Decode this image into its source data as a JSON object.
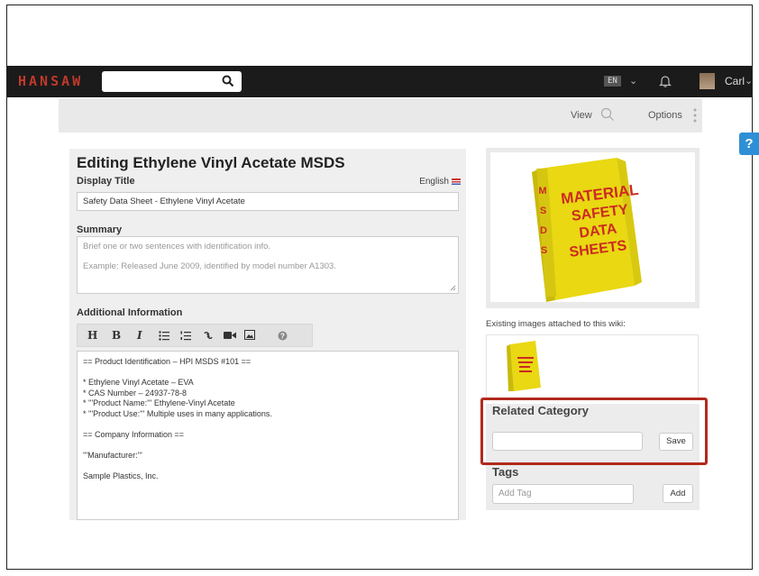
{
  "nav": {
    "logo": "HANSAW",
    "language": "EN",
    "user_name": "Carl"
  },
  "subbar": {
    "view_label": "View",
    "options_label": "Options"
  },
  "help_label": "?",
  "editor": {
    "heading": "Editing Ethylene Vinyl Acetate MSDS",
    "display_title_label": "Display Title",
    "language_label": "English",
    "display_title_value": "Safety Data Sheet - Ethylene Vinyl Acetate",
    "summary_label": "Summary",
    "summary_placeholder_line1": "Brief one or two sentences with identification info.",
    "summary_placeholder_line2": "Example: Released June 2009, identified by model number A1303.",
    "additional_label": "Additional Information",
    "toolbar": {
      "heading": "H",
      "bold": "B",
      "italic": "I"
    },
    "content_lines": [
      "== Product Identification – HPI MSDS #101 ==",
      "",
      "* Ethylene Vinyl Acetate – EVA",
      "* CAS Number – 24937-78-8",
      "* '''Product Name:''' Ethylene-Vinyl Acetate",
      "* '''Product Use:''' Multiple uses in many applications.",
      "",
      "== Company Information ==",
      "",
      "'''Manufacturer:'''",
      "",
      "Sample Plastics, Inc."
    ]
  },
  "sidebar": {
    "binder_lines": [
      "MATERIAL",
      "SAFETY",
      "DATA",
      "SHEETS"
    ],
    "binder_spine": [
      "M",
      "S",
      "D",
      "S"
    ],
    "existing_images_label": "Existing images attached to this wiki:",
    "related_category_title": "Related Category",
    "save_label": "Save",
    "tags_title": "Tags",
    "add_tag_placeholder": "Add Tag",
    "add_label": "Add"
  },
  "colors": {
    "brand": "#c0392b",
    "highlight": "#b22a1d",
    "help": "#2f8fd6",
    "binder": "#f2e21c"
  }
}
